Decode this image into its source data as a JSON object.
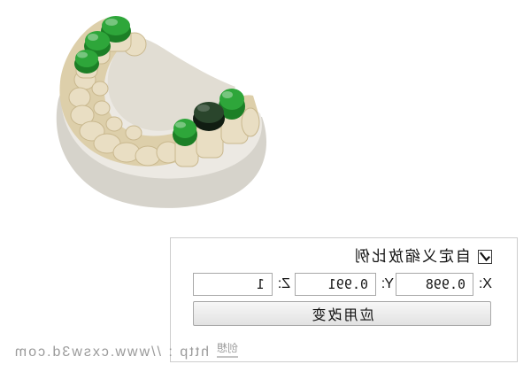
{
  "colors": {
    "plaster_top": "#ece9e3",
    "plaster_side": "#d6d3cb",
    "palate": "#e1ddd3",
    "gum": "#ddcfaa",
    "tooth": "#e9dec3",
    "tooth_edge": "#c9b88e",
    "cap_green": "#2ea63a",
    "cap_green_shade": "#1c7f26",
    "cap_dark": "#2a452c",
    "cap_dark_shade": "#111d12",
    "watermark": "#9a9a9a"
  },
  "scale_panel": {
    "custom_scale_checked": true,
    "custom_scale_label": "自定义缩放比例",
    "x_label": "X:",
    "x_value": "0.998",
    "y_label": "Y:",
    "y_value": "0.991",
    "z_label": "Z:",
    "z_value": "1",
    "apply_button_label": "应用改变"
  },
  "watermark": {
    "logo_text": "创想",
    "url_text": "http : //www.cxsw3d.com"
  },
  "icons": {
    "checkbox_mark": "checkmark-icon"
  }
}
